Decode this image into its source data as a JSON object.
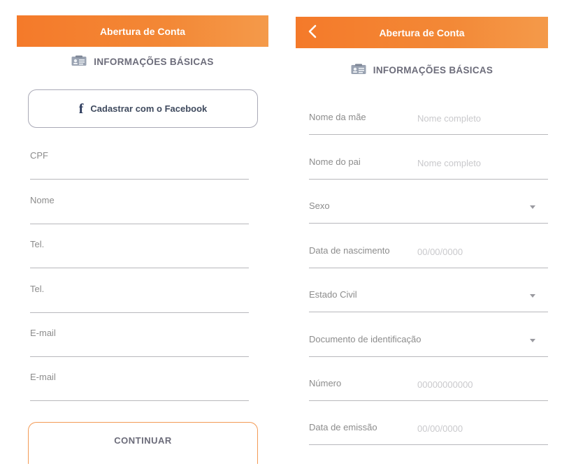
{
  "left_screen": {
    "title": "Abertura de Conta",
    "section_title": "INFORMAÇÕES BÁSICAS",
    "facebook_button": {
      "icon_glyph": "f",
      "label": "Cadastrar com o Facebook"
    },
    "fields": [
      {
        "label": "CPF"
      },
      {
        "label": "Nome"
      },
      {
        "label": "Tel."
      },
      {
        "label": "Tel."
      },
      {
        "label": "E-mail"
      },
      {
        "label": "E-mail"
      }
    ],
    "continue_label": "CONTINUAR"
  },
  "right_screen": {
    "title": "Abertura de Conta",
    "section_title": "INFORMAÇÕES BÁSICAS",
    "fields": [
      {
        "label": "Nome da mãe",
        "placeholder": "Nome completo"
      },
      {
        "label": "Nome do pai",
        "placeholder": "Nome completo"
      },
      {
        "label": "Sexo",
        "dropdown": true
      },
      {
        "label": "Data de nascimento",
        "placeholder": "00/00/0000"
      },
      {
        "label": "Estado Civil",
        "dropdown": true
      },
      {
        "label": "Documento de identificação",
        "dropdown": true
      },
      {
        "label": "Número",
        "placeholder": "00000000000"
      },
      {
        "label": "Data de emissão",
        "placeholder": "00/00/0000"
      }
    ]
  },
  "colors": {
    "brand_orange": "#f47a2a",
    "continue_border": "#f39a55",
    "text_gray": "#8c8c8c",
    "placeholder_gray": "#c9c9cc"
  },
  "icons": {
    "back": "chevron-left-icon",
    "section": "id-card-icon",
    "facebook": "facebook-icon",
    "dropdown": "chevron-down-icon"
  }
}
